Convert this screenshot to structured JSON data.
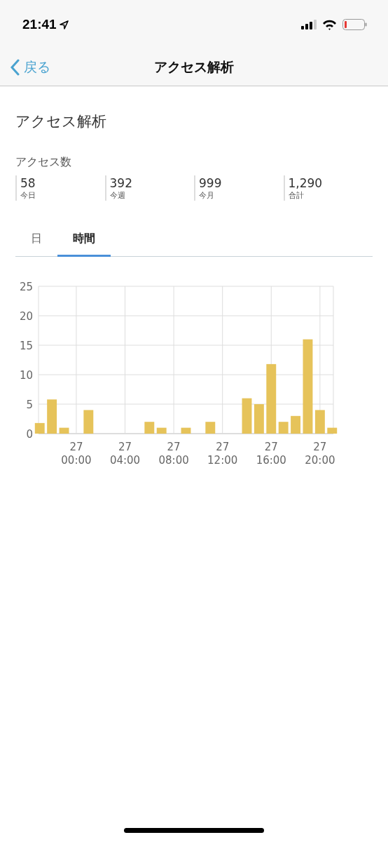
{
  "status_bar": {
    "time": "21:41"
  },
  "nav_bar": {
    "back": "戻る",
    "title": "アクセス解析"
  },
  "heading": "アクセス解析",
  "access": {
    "title": "アクセス数",
    "stats": [
      {
        "value": "58",
        "label": "今日"
      },
      {
        "value": "392",
        "label": "今週"
      },
      {
        "value": "999",
        "label": "今月"
      },
      {
        "value": "1,290",
        "label": "合計"
      }
    ]
  },
  "tabs": [
    {
      "label": "日",
      "selected": false
    },
    {
      "label": "時間",
      "selected": true
    }
  ],
  "chart": {
    "chart_data": {
      "type": "bar",
      "categories": [
        null,
        null,
        null,
        "27 00:00",
        null,
        null,
        null,
        "27 04:00",
        null,
        null,
        null,
        "27 08:00",
        null,
        null,
        null,
        "27 12:00",
        null,
        null,
        null,
        "27 16:00",
        null,
        null,
        null,
        "27 20:00",
        null
      ],
      "series": [
        {
          "color": "#e6c35a",
          "values": [
            1.8,
            5.8,
            1,
            0,
            4,
            0,
            0,
            0,
            0,
            2,
            1,
            0,
            1,
            0,
            2,
            0,
            0,
            6,
            5,
            11.8,
            2,
            3,
            16,
            4,
            1
          ]
        }
      ],
      "grid": true,
      "ylim": [
        0,
        25
      ],
      "yticks": [
        0,
        5,
        10,
        15,
        20,
        25
      ]
    }
  }
}
